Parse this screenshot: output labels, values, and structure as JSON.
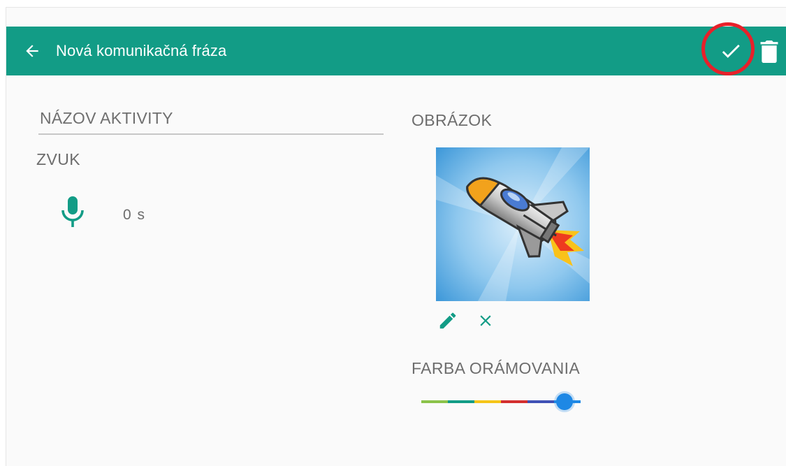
{
  "toolbar": {
    "title": "Nová komunikačná fráza",
    "back_icon": "arrow-left-icon",
    "confirm_icon": "checkmark-icon",
    "delete_icon": "trash-icon",
    "background_color": "#129c86",
    "highlight_color": "#e8202a"
  },
  "form": {
    "name_placeholder": "NÁZOV AKTIVITY",
    "name_value": "",
    "sound_label": "ZVUK",
    "sound_icon": "microphone-icon",
    "sound_duration": "0 s",
    "image_label": "OBRÁZOK",
    "image_subject": "rocket",
    "edit_icon": "pencil-icon",
    "remove_icon": "close-icon",
    "accent_color": "#129c86"
  },
  "border_color": {
    "label": "FARBA ORÁMOVANIA",
    "segments": [
      "#8bc34a",
      "#129c86",
      "#f5c518",
      "#d32f2f",
      "#3f51b5",
      "#1e88e5"
    ],
    "selected_index": 5,
    "value": 0.9
  }
}
